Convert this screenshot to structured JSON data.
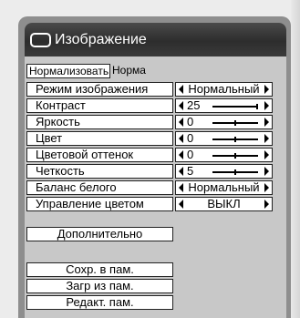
{
  "title": "Изображение",
  "tabs": [
    {
      "label": "Нормализовать",
      "active": true
    },
    {
      "label": "Норма",
      "active": false
    }
  ],
  "settings": [
    {
      "label": "Режим изображения",
      "type": "select",
      "value": "Нормальный"
    },
    {
      "label": "Контраст",
      "type": "slider",
      "value": "25",
      "level": 1.0
    },
    {
      "label": "Яркость",
      "type": "slider",
      "value": "0",
      "level": 0.5
    },
    {
      "label": "Цвет",
      "type": "slider",
      "value": "0",
      "level": 0.5
    },
    {
      "label": "Цветовой оттенок",
      "type": "slider",
      "value": "0",
      "level": 0.5
    },
    {
      "label": "Четкость",
      "type": "slider",
      "value": "5",
      "level": 0.5
    },
    {
      "label": "Баланс белого",
      "type": "select",
      "value": "Нормальный"
    },
    {
      "label": "Управление цветом",
      "type": "select",
      "value": "ВЫКЛ"
    }
  ],
  "advanced_button": "Дополнительно",
  "memory_buttons": [
    "Сохр. в пам.",
    "Загр из пам.",
    "Редакт. пам."
  ],
  "icons": {
    "title": "monitor-icon",
    "left": "arrow-left-icon",
    "right": "arrow-right-icon"
  },
  "colors": {
    "titlebar": "#333333",
    "panel": "#c8c8c8",
    "field": "#ffffff"
  }
}
